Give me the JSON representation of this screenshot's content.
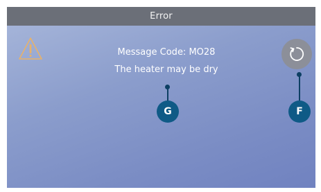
{
  "header": {
    "title": "Error"
  },
  "alert": {
    "icon": "warning-icon",
    "code_line": "Message Code: MO28",
    "description": "The heater may be dry"
  },
  "refresh_button": {
    "icon": "refresh-icon"
  },
  "callouts": {
    "g": "G",
    "f": "F"
  },
  "colors": {
    "header_bg": "#6b6f78",
    "warning": "#e8b26a",
    "callout": "#0f5a86",
    "refresh_bg": "#8c8f99"
  }
}
